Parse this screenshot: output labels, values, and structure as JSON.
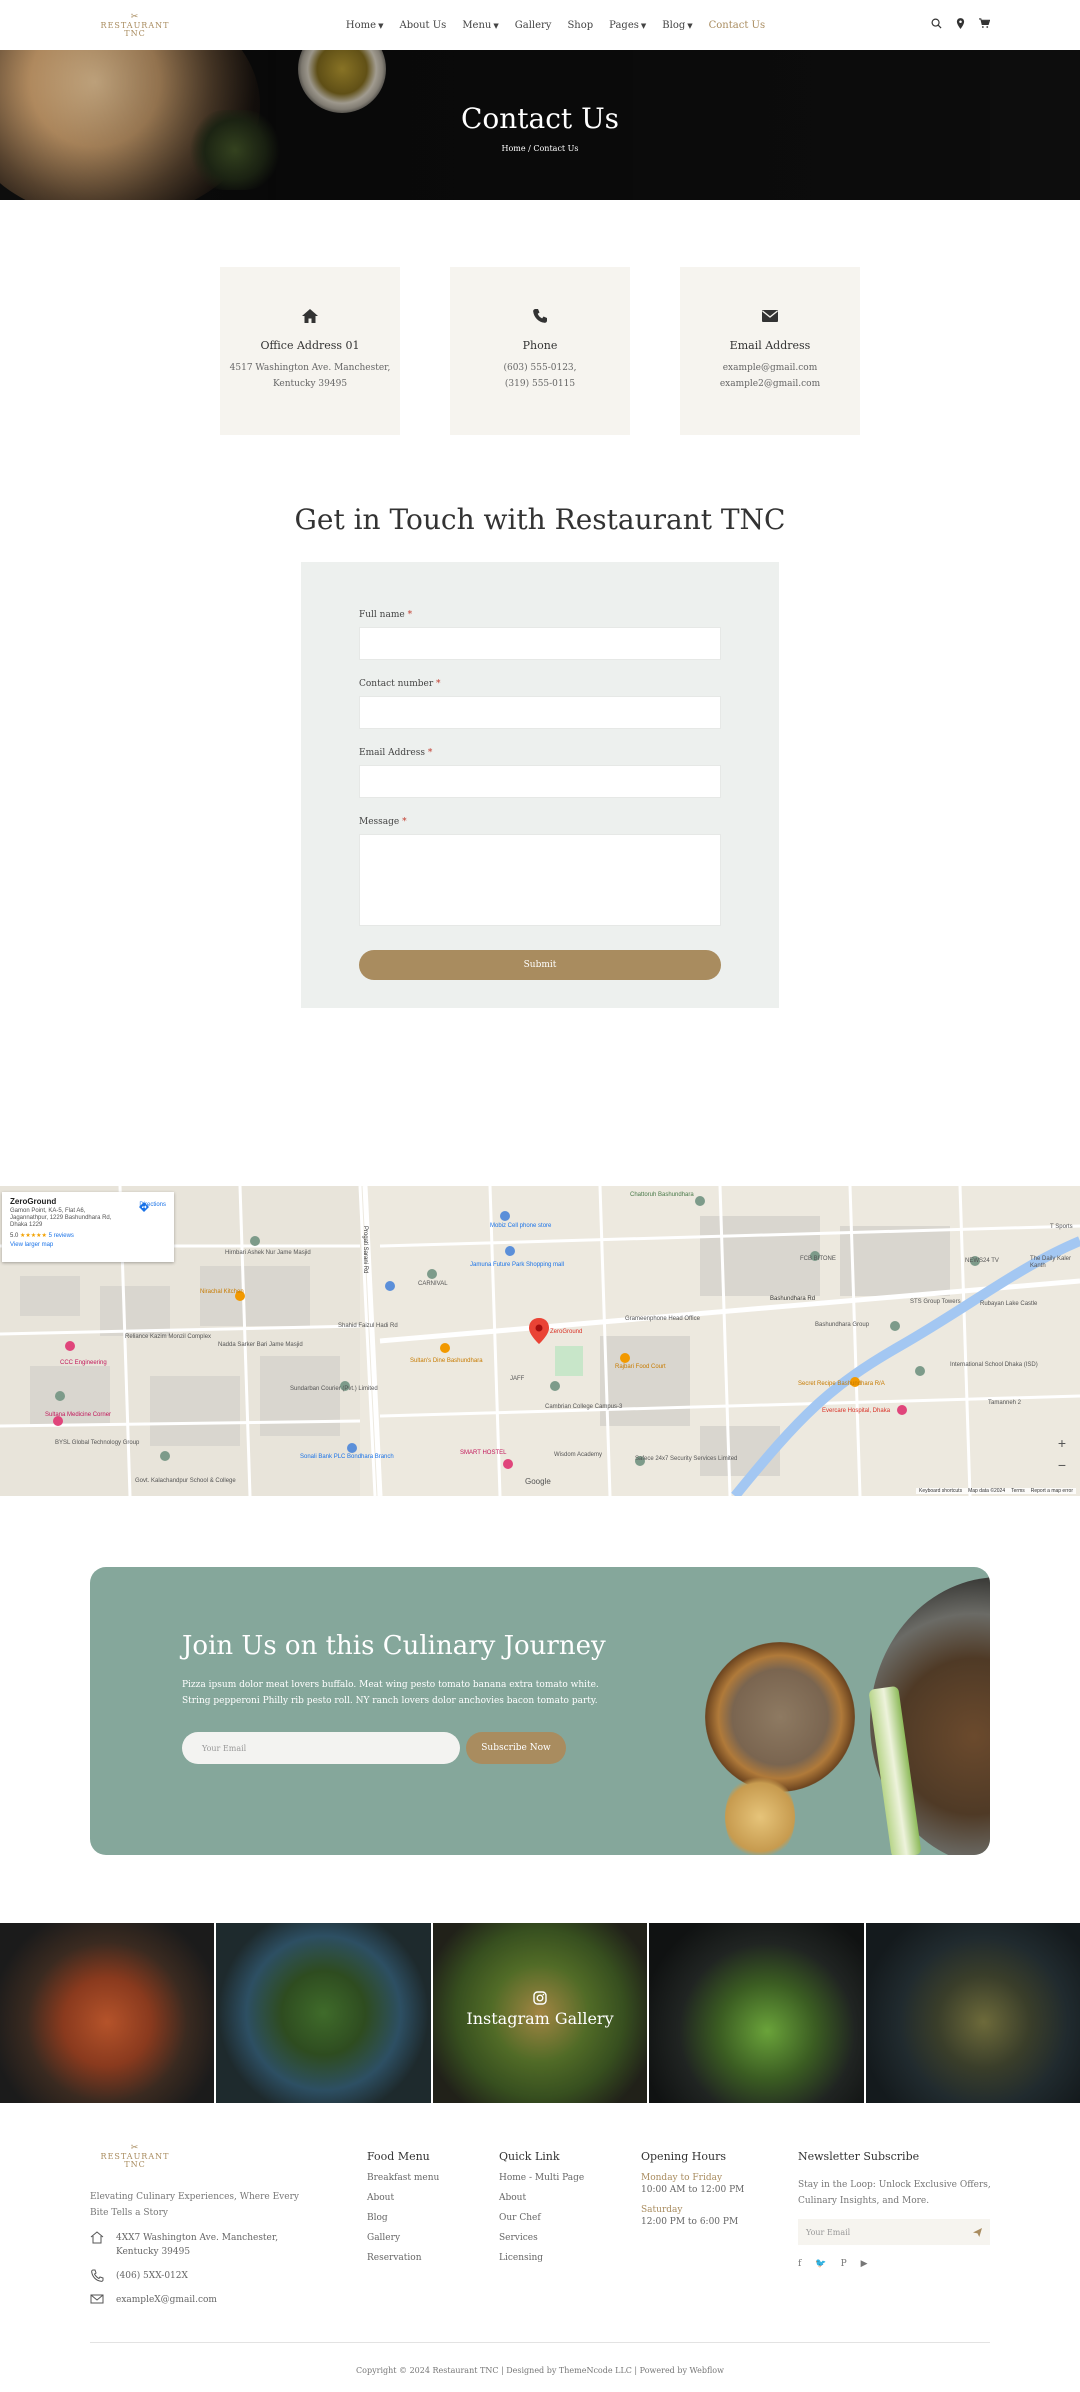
{
  "header": {
    "brand": "RESTAURANT TNC",
    "nav": [
      {
        "label": "Home",
        "has_menu": true
      },
      {
        "label": "About Us",
        "has_menu": false
      },
      {
        "label": "Menu",
        "has_menu": true
      },
      {
        "label": "Gallery",
        "has_menu": false
      },
      {
        "label": "Shop",
        "has_menu": false
      },
      {
        "label": "Pages",
        "has_menu": true
      },
      {
        "label": "Blog",
        "has_menu": true
      },
      {
        "label": "Contact Us",
        "has_menu": false
      }
    ],
    "icons": [
      "search-icon",
      "location-pin-icon",
      "cart-icon"
    ]
  },
  "hero": {
    "title": "Contact Us",
    "breadcrumb": "Home / Contact Us"
  },
  "cards": [
    {
      "icon": "home-icon",
      "title": "Office Address 01",
      "lines": [
        "4517 Washington Ave. Manchester,",
        "Kentucky 39495"
      ]
    },
    {
      "icon": "phone-icon",
      "title": "Phone",
      "lines": [
        "(603) 555-0123,",
        "(319) 555-0115"
      ]
    },
    {
      "icon": "envelope-icon",
      "title": "Email Address",
      "lines": [
        "example@gmail.com",
        "example2@gmail.com"
      ]
    }
  ],
  "form": {
    "title": "Get in Touch with Restaurant TNC",
    "fields": [
      {
        "label": "Full name",
        "required": "*"
      },
      {
        "label": "Contact number",
        "required": "*"
      },
      {
        "label": "Email Address",
        "required": "*"
      },
      {
        "label": "Message",
        "required": "*"
      }
    ],
    "submit": "Submit"
  },
  "map": {
    "place_name": "ZeroGround",
    "address": "Gamon Point, KA-5, Flat A6, Jagannathpur, 1229 Bashundhara Rd, Dhaka 1229",
    "rating": "5.0",
    "stars": "★★★★★",
    "reviews": "5 reviews",
    "larger_map": "View larger map",
    "directions": "Directions",
    "zoom_in": "+",
    "zoom_out": "−",
    "brand": "Google",
    "footer": [
      "Keyboard shortcuts",
      "Map data ©2024",
      "Terms",
      "Report a map error"
    ],
    "labels": [
      {
        "text": "Chattoruh Bashundhara",
        "color": "#4a7a4a"
      },
      {
        "text": "Hirnbari Ashek Nur Jame Masjid",
        "color": "#555"
      },
      {
        "text": "Nirachal Kitchen",
        "color": "#c77b00"
      },
      {
        "text": "Nadda Sarker Bari Jame Masjid",
        "color": "#555"
      },
      {
        "text": "CCC Engineering",
        "color": "#c2185b"
      },
      {
        "text": "Sultana Medicine Corner",
        "color": "#c2185b"
      },
      {
        "text": "BYSL Global Technology Group",
        "color": "#555"
      },
      {
        "text": "Govt. Kalachandpur School & College",
        "color": "#555"
      },
      {
        "text": "Sundarban Courier (Pvt.) Limited",
        "color": "#555"
      },
      {
        "text": "Sonali Bank PLC Bondhara Branch",
        "color": "#1a73e8"
      },
      {
        "text": "Mobiz Cell phone store",
        "color": "#1a73e8"
      },
      {
        "text": "Jamuna Future Park Shopping mall",
        "color": "#1a73e8"
      },
      {
        "text": "CARNIVAL",
        "color": "#555"
      },
      {
        "text": "Sultan's Dine Bashundhara",
        "color": "#c77b00"
      },
      {
        "text": "JAFF",
        "color": "#555"
      },
      {
        "text": "ZeroGround",
        "color": "#d93025"
      },
      {
        "text": "Grameenphone Head Office",
        "color": "#555"
      },
      {
        "text": "Rajbari Food Court",
        "color": "#c77b00"
      },
      {
        "text": "Cambrian College Campus-3",
        "color": "#555"
      },
      {
        "text": "SMART HOSTEL",
        "color": "#c2185b"
      },
      {
        "text": "Wisdom Academy",
        "color": "#555"
      },
      {
        "text": "Safece 24x7 Security Services Limited",
        "color": "#555"
      },
      {
        "text": "Bashundhara Rd",
        "color": "#333"
      },
      {
        "text": "STS Group Towers",
        "color": "#555"
      },
      {
        "text": "NEWS24 TV",
        "color": "#555"
      },
      {
        "text": "Rubayan Lake Castle",
        "color": "#555"
      },
      {
        "text": "Secret Recipe Bashundhara R/A",
        "color": "#c77b00"
      },
      {
        "text": "International School Dhaka (ISD)",
        "color": "#555"
      },
      {
        "text": "Evercare Hospital, Dhaka",
        "color": "#d93025"
      },
      {
        "text": "Tamanneh 2",
        "color": "#555"
      },
      {
        "text": "Progati Sarani Rd",
        "color": "#333"
      },
      {
        "text": "Shahid Faizul Hadi Rd",
        "color": "#555"
      },
      {
        "text": "Reliance Kazim Monzil Complex",
        "color": "#555"
      },
      {
        "text": "FCB BITONE",
        "color": "#555"
      },
      {
        "text": "Bashundhara Group",
        "color": "#555"
      },
      {
        "text": "The Daily Kaler Kanth",
        "color": "#555"
      },
      {
        "text": "T Sports",
        "color": "#555"
      }
    ]
  },
  "banner": {
    "title": "Join Us on this Culinary Journey",
    "text": "Pizza ipsum dolor meat lovers buffalo. Meat wing pesto tomato banana extra tomato white. String pepperoni Philly rib pesto roll. NY ranch lovers dolor anchovies bacon tomato party.",
    "email_placeholder": "Your Email",
    "button": "Subscribe Now"
  },
  "gallery": {
    "label": "Instagram Gallery"
  },
  "footer": {
    "brand": "RESTAURANT TNC",
    "tagline": "Elevating Culinary Experiences, Where Every Bite Tells a Story",
    "address": "4XX7 Washington Ave. Manchester, Kentucky 39495",
    "phone": "(406) 5XX-012X",
    "email": "exampleX@gmail.com",
    "menu_title": "Food Menu",
    "menu_items": [
      "Breakfast menu",
      "About",
      "Blog",
      "Gallery",
      "Reservation"
    ],
    "quick_title": "Quick Link",
    "quick_items": [
      "Home - Multi Page",
      "About",
      "Our Chef",
      "Services",
      "Licensing"
    ],
    "hours_title": "Opening Hours",
    "hours": [
      {
        "day": "Monday to Friday",
        "time": "10:00 AM to 12:00 PM"
      },
      {
        "day": "Saturday",
        "time": "12:00 PM to 6:00 PM"
      }
    ],
    "news_title": "Newsletter Subscribe",
    "news_text": "Stay in the Loop: Unlock Exclusive Offers, Culinary Insights, and More.",
    "news_placeholder": "Your Email",
    "social": [
      "f",
      "🐦",
      "P",
      "▶"
    ],
    "copyright": "Copyright © 2024 Restaurant TNC  |   Designed by ThemeNcode LLC  |  Powered by Webflow"
  },
  "colors": {
    "accent": "#a98c5f",
    "banner": "#85a79b",
    "card_bg": "#f6f4ef",
    "form_bg": "#edf0ee"
  }
}
